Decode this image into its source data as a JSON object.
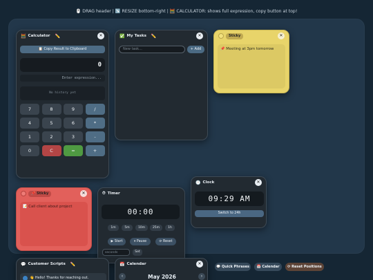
{
  "hint": "🖱️ DRAG header | ↘️ RESIZE bottom-right | 🧮 CALCULATOR: shows full expression, copy button at top!",
  "calculator": {
    "icon": "🧮",
    "title": "Calculator",
    "edit_icon": "✏️",
    "copy_label": "📋 Copy Result to Clipboard",
    "display": "0",
    "expression_placeholder": "Enter expression...",
    "history": "No history yet",
    "keys": [
      "7",
      "8",
      "9",
      "/",
      "4",
      "5",
      "6",
      "*",
      "1",
      "2",
      "3",
      "-",
      "0",
      "C",
      "=",
      "+"
    ]
  },
  "tasks": {
    "icon": "✅",
    "title": "My Tasks",
    "edit_icon": "✏️",
    "input_placeholder": "New task...",
    "add_label": "+ Add"
  },
  "sticky_yellow": {
    "tag": "Sticky",
    "note": "📌 Meeting at 3pm tomorrow",
    "color": "#e8d46a"
  },
  "sticky_red": {
    "tag": "📌 Sticky",
    "note": "📝 Call client about project",
    "color": "#e2605b"
  },
  "timer": {
    "icon": "⏱",
    "title": "Timer",
    "display": "00:00",
    "presets": [
      "1m",
      "5m",
      "10m",
      "25m",
      "1h"
    ],
    "start_label": "▶ Start",
    "pause_label": "⏸ Pause",
    "reset_label": "⟳ Reset",
    "seconds_placeholder": "seconds",
    "set_label": "Set"
  },
  "clock": {
    "icon": "🕐",
    "title": "Clock",
    "time": "09:29 AM",
    "toggle_label": "Switch to 24h"
  },
  "customer_scripts": {
    "icon": "💬",
    "title": "Customer Scripts",
    "edit_icon": "✏️",
    "message": "👋 Hello! Thanks for reaching out."
  },
  "calendar": {
    "icon": "📅",
    "title": "Calendar",
    "month": "May 2026"
  },
  "bottom_bar": {
    "quick_phrases": "💬 Quick Phrases",
    "calendar": "📅 Calendar",
    "reset_positions": "⟳ Reset Positions"
  },
  "close_symbol": "✕"
}
